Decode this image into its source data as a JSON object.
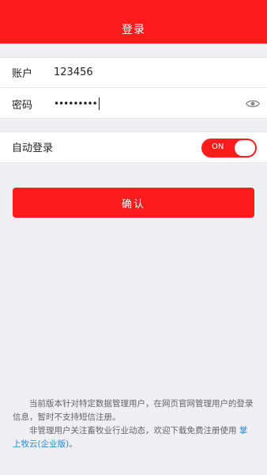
{
  "header": {
    "title": "登录"
  },
  "form": {
    "account_label": "账户",
    "account_value": "123456",
    "password_label": "密码",
    "password_masked": "•••••••••"
  },
  "auto_login": {
    "label": "自动登录",
    "switch_text": "ON"
  },
  "confirm_label": "确认",
  "notice": {
    "line1": "当前版本针对特定数据管理用户，在网页官网管理用户的登录信息，暂时不支持短信注册。",
    "line2_prefix": "非管理用户关注畜牧业行业动态，欢迎下载免费注册使用 ",
    "line2_link": "掌上牧云(企业版)",
    "line2_suffix": "。"
  },
  "colors": {
    "accent": "#fd1b1b",
    "link": "#1e88d2",
    "background": "#efeff4"
  },
  "icons": {
    "password_visibility": "eye-icon"
  }
}
